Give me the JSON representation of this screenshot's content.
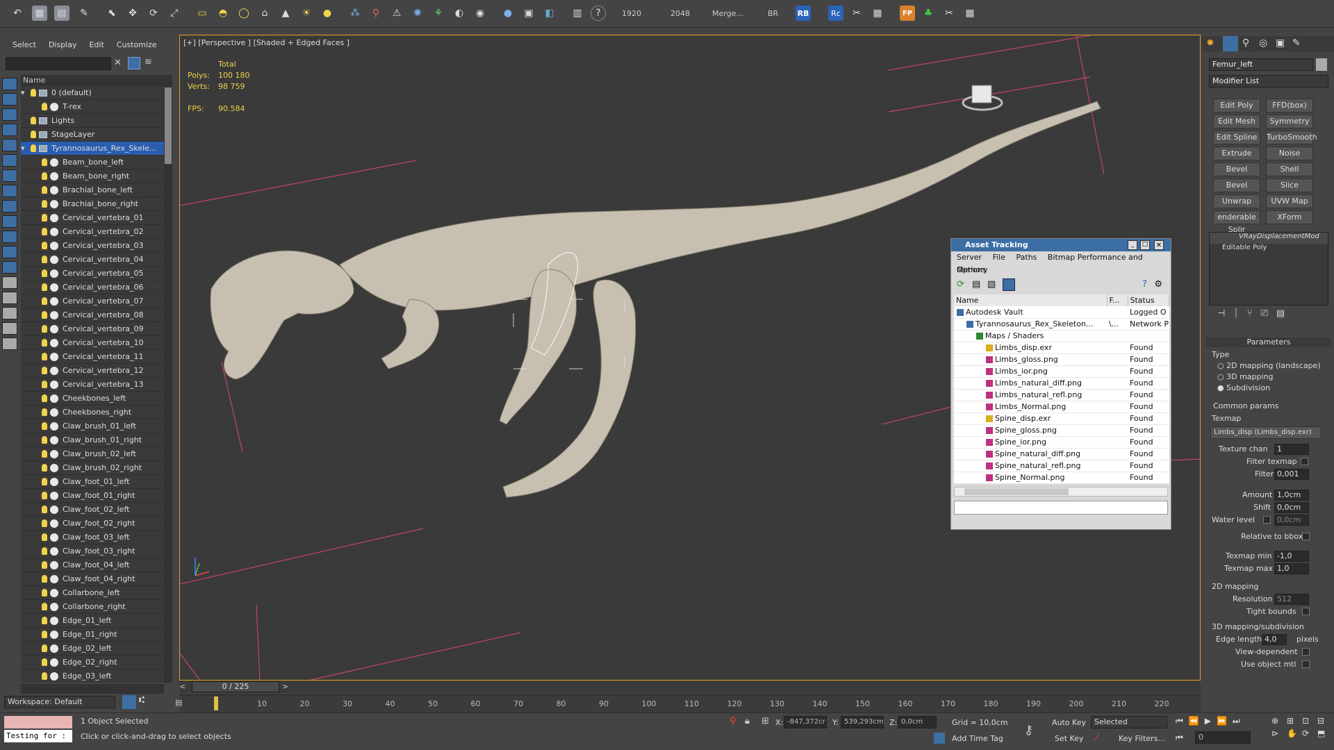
{
  "toolbar": {
    "render_width": "1920",
    "render_height": "2048",
    "merge_label": "Merge...",
    "br_label": "BR",
    "rb_label": "RB",
    "rc_label": "Rc",
    "fp_label": "FP"
  },
  "scene_explorer": {
    "menu": [
      "Select",
      "Display",
      "Edit",
      "Customize"
    ],
    "column_name": "Name",
    "items": [
      {
        "label": "0 (default)",
        "depth": 0,
        "kind": "layer"
      },
      {
        "label": "T-rex",
        "depth": 1,
        "kind": "object"
      },
      {
        "label": "Lights",
        "depth": 0,
        "kind": "layer"
      },
      {
        "label": "StageLayer",
        "depth": 0,
        "kind": "layer"
      },
      {
        "label": "Tyrannosaurus_Rex_Skele...",
        "depth": 0,
        "kind": "layer",
        "selected": true
      },
      {
        "label": "Beam_bone_left",
        "depth": 1,
        "kind": "object"
      },
      {
        "label": "Beam_bone_right",
        "depth": 1,
        "kind": "object"
      },
      {
        "label": "Brachial_bone_left",
        "depth": 1,
        "kind": "object"
      },
      {
        "label": "Brachial_bone_right",
        "depth": 1,
        "kind": "object"
      },
      {
        "label": "Cervical_vertebra_01",
        "depth": 1,
        "kind": "object"
      },
      {
        "label": "Cervical_vertebra_02",
        "depth": 1,
        "kind": "object"
      },
      {
        "label": "Cervical_vertebra_03",
        "depth": 1,
        "kind": "object"
      },
      {
        "label": "Cervical_vertebra_04",
        "depth": 1,
        "kind": "object"
      },
      {
        "label": "Cervical_vertebra_05",
        "depth": 1,
        "kind": "object"
      },
      {
        "label": "Cervical_vertebra_06",
        "depth": 1,
        "kind": "object"
      },
      {
        "label": "Cervical_vertebra_07",
        "depth": 1,
        "kind": "object"
      },
      {
        "label": "Cervical_vertebra_08",
        "depth": 1,
        "kind": "object"
      },
      {
        "label": "Cervical_vertebra_09",
        "depth": 1,
        "kind": "object"
      },
      {
        "label": "Cervical_vertebra_10",
        "depth": 1,
        "kind": "object"
      },
      {
        "label": "Cervical_vertebra_11",
        "depth": 1,
        "kind": "object"
      },
      {
        "label": "Cervical_vertebra_12",
        "depth": 1,
        "kind": "object"
      },
      {
        "label": "Cervical_vertebra_13",
        "depth": 1,
        "kind": "object"
      },
      {
        "label": "Cheekbones_left",
        "depth": 1,
        "kind": "object"
      },
      {
        "label": "Cheekbones_right",
        "depth": 1,
        "kind": "object"
      },
      {
        "label": "Claw_brush_01_left",
        "depth": 1,
        "kind": "object"
      },
      {
        "label": "Claw_brush_01_right",
        "depth": 1,
        "kind": "object"
      },
      {
        "label": "Claw_brush_02_left",
        "depth": 1,
        "kind": "object"
      },
      {
        "label": "Claw_brush_02_right",
        "depth": 1,
        "kind": "object"
      },
      {
        "label": "Claw_foot_01_left",
        "depth": 1,
        "kind": "object"
      },
      {
        "label": "Claw_foot_01_right",
        "depth": 1,
        "kind": "object"
      },
      {
        "label": "Claw_foot_02_left",
        "depth": 1,
        "kind": "object"
      },
      {
        "label": "Claw_foot_02_right",
        "depth": 1,
        "kind": "object"
      },
      {
        "label": "Claw_foot_03_left",
        "depth": 1,
        "kind": "object"
      },
      {
        "label": "Claw_foot_03_right",
        "depth": 1,
        "kind": "object"
      },
      {
        "label": "Claw_foot_04_left",
        "depth": 1,
        "kind": "object"
      },
      {
        "label": "Claw_foot_04_right",
        "depth": 1,
        "kind": "object"
      },
      {
        "label": "Collarbone_left",
        "depth": 1,
        "kind": "object"
      },
      {
        "label": "Collarbone_right",
        "depth": 1,
        "kind": "object"
      },
      {
        "label": "Edge_01_left",
        "depth": 1,
        "kind": "object"
      },
      {
        "label": "Edge_01_right",
        "depth": 1,
        "kind": "object"
      },
      {
        "label": "Edge_02_left",
        "depth": 1,
        "kind": "object"
      },
      {
        "label": "Edge_02_right",
        "depth": 1,
        "kind": "object"
      },
      {
        "label": "Edge_03_left",
        "depth": 1,
        "kind": "object"
      }
    ],
    "workspace": "Workspace: Default"
  },
  "viewport": {
    "label": "[+] [Perspective ] [Shaded + Edged Faces ]",
    "stats_total": "Total",
    "polys_label": "Polys:",
    "polys_value": "100 180",
    "verts_label": "Verts:",
    "verts_value": "98 759",
    "fps_label": "FPS:",
    "fps_value": "90.584"
  },
  "asset_tracking": {
    "title": "Asset Tracking",
    "menu": [
      "Server",
      "File",
      "Paths",
      "Bitmap Performance and Memory"
    ],
    "menu2": "Options",
    "columns": [
      "Name",
      "F...",
      "Status"
    ],
    "rows": [
      {
        "name": "Autodesk Vault",
        "f": "",
        "status": "Logged O",
        "depth": 0
      },
      {
        "name": "Tyrannosaurus_Rex_Skeleton...",
        "f": "\\...",
        "status": "Network P",
        "depth": 1
      },
      {
        "name": "Maps / Shaders",
        "f": "",
        "status": "",
        "depth": 2
      },
      {
        "name": "Limbs_disp.exr",
        "f": "",
        "status": "Found",
        "depth": 3
      },
      {
        "name": "Limbs_gloss.png",
        "f": "",
        "status": "Found",
        "depth": 3
      },
      {
        "name": "Limbs_ior.png",
        "f": "",
        "status": "Found",
        "depth": 3
      },
      {
        "name": "Limbs_natural_diff.png",
        "f": "",
        "status": "Found",
        "depth": 3
      },
      {
        "name": "Limbs_natural_refl.png",
        "f": "",
        "status": "Found",
        "depth": 3
      },
      {
        "name": "Limbs_Normal.png",
        "f": "",
        "status": "Found",
        "depth": 3
      },
      {
        "name": "Spine_disp.exr",
        "f": "",
        "status": "Found",
        "depth": 3
      },
      {
        "name": "Spine_gloss.png",
        "f": "",
        "status": "Found",
        "depth": 3
      },
      {
        "name": "Spine_ior.png",
        "f": "",
        "status": "Found",
        "depth": 3
      },
      {
        "name": "Spine_natural_diff.png",
        "f": "",
        "status": "Found",
        "depth": 3
      },
      {
        "name": "Spine_natural_refl.png",
        "f": "",
        "status": "Found",
        "depth": 3
      },
      {
        "name": "Spine_Normal.png",
        "f": "",
        "status": "Found",
        "depth": 3
      }
    ]
  },
  "command_panel": {
    "object_name": "Femur_left",
    "modifier_list": "Modifier List",
    "buttons": [
      [
        "Edit Poly",
        "FFD(box)"
      ],
      [
        "Edit Mesh",
        "Symmetry"
      ],
      [
        "Edit Spline",
        "TurboSmooth"
      ],
      [
        "Extrude",
        "Noise"
      ],
      [
        "Bevel",
        "Shell"
      ],
      [
        "Bevel Profile",
        "Slice"
      ],
      [
        "Unwrap UVW",
        "UVW Map"
      ],
      [
        "enderable Splir",
        "XForm"
      ]
    ],
    "stack": [
      "VRayDisplacementMod",
      "Editable Poly"
    ],
    "parameters_title": "Parameters",
    "type_label": "Type",
    "type_options": [
      "2D mapping (landscape)",
      "3D mapping",
      "Subdivision"
    ],
    "common_params": "Common params",
    "texmap_label": "Texmap",
    "texmap_value": "Limbs_disp (Limbs_disp.exr)",
    "texture_chan_label": "Texture chan",
    "texture_chan_value": "1",
    "filter_texmap_label": "Filter texmap",
    "filter_blur_label": "Filter blur",
    "filter_blur_value": "0,001",
    "amount_label": "Amount",
    "amount_value": "1,0cm",
    "shift_label": "Shift",
    "shift_value": "0,0cm",
    "water_level_label": "Water level",
    "water_level_value": "0,0cm",
    "relative_bbox_label": "Relative to bbox",
    "texmap_min_label": "Texmap min",
    "texmap_min_value": "-1,0",
    "texmap_max_label": "Texmap max",
    "texmap_max_value": "1,0",
    "mapping2d_label": "2D mapping",
    "resolution_label": "Resolution",
    "resolution_value": "512",
    "tight_bounds_label": "Tight bounds",
    "mapping3d_label": "3D mapping/subdivision",
    "edge_length_label": "Edge length",
    "edge_length_value": "4,0",
    "pixels_label": "pixels",
    "view_dependent_label": "View-dependent",
    "use_object_mtl_label": "Use object mtl"
  },
  "timeline": {
    "frame_counter": "0 / 225",
    "ticks": [
      "10",
      "20",
      "30",
      "40",
      "50",
      "60",
      "70",
      "80",
      "90",
      "100",
      "110",
      "120",
      "130",
      "140",
      "150",
      "160",
      "170",
      "180",
      "190",
      "200",
      "210",
      "220"
    ]
  },
  "status_bar": {
    "script_text": "Testing for :",
    "selection": "1 Object Selected",
    "prompt": "Click or click-and-drag to select objects",
    "x_label": "X:",
    "x_value": "-847,372cr",
    "y_label": "Y:",
    "y_value": "539,293cm",
    "z_label": "Z:",
    "z_value": "0,0cm",
    "grid": "Grid = 10,0cm",
    "add_time_tag": "Add Time Tag",
    "auto_key": "Auto Key",
    "selected_dropdown": "Selected",
    "set_key": "Set Key",
    "key_filters": "Key Filters...",
    "frame_value": "0"
  }
}
